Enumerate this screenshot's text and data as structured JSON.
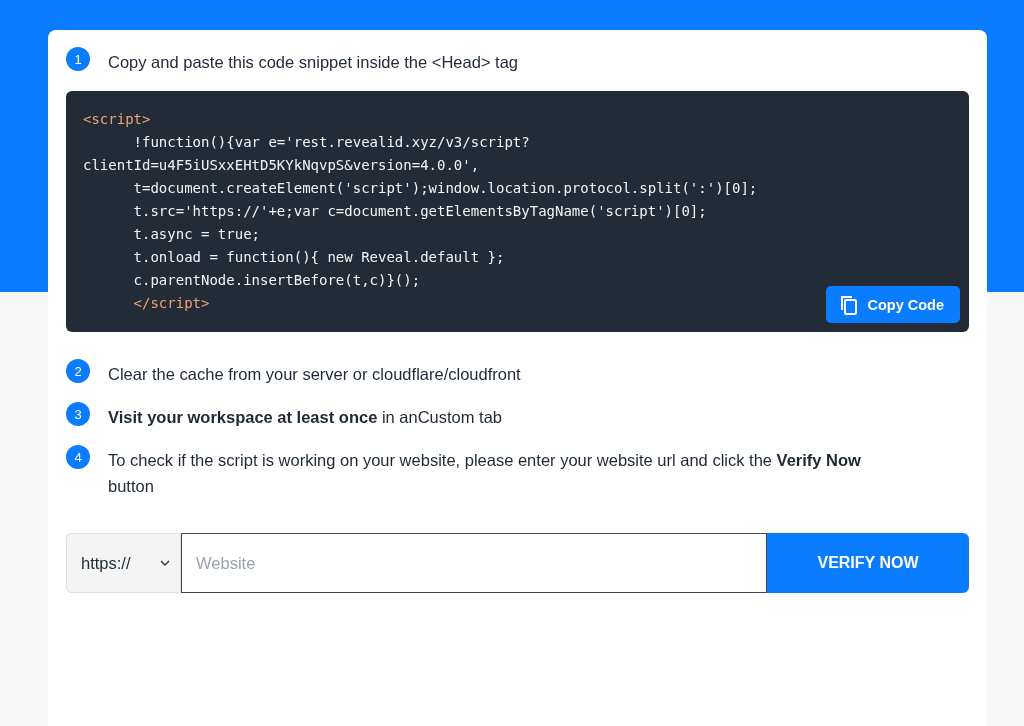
{
  "steps": [
    {
      "number": "1",
      "text": "Copy and paste this code snippet inside the <Head> tag"
    },
    {
      "number": "2",
      "text": "Clear the cache from your server or cloudflare/cloudfront"
    },
    {
      "number": "3",
      "text": "**Visit your workspace at least once** in anCustom tab"
    },
    {
      "number": "4",
      "text": "To check if the script is working on your website, please enter your website url and click the **Verify Now** button"
    }
  ],
  "code": {
    "lines": [
      {
        "kind": "tag",
        "text": "<script>"
      },
      {
        "kind": "code",
        "text": "      !function(){var e='rest.revealid.xyz/v3/script?"
      },
      {
        "kind": "code",
        "text": "clientId=u4F5iUSxxEHtD5KYkNqvpS&version=4.0.0',"
      },
      {
        "kind": "code",
        "text": "      t=document.createElement('script');window.location.protocol.split(':')[0];"
      },
      {
        "kind": "code",
        "text": "      t.src='https://'+e;var c=document.getElementsByTagName('script')[0];"
      },
      {
        "kind": "code",
        "text": "      t.async = true;"
      },
      {
        "kind": "code",
        "text": "      t.onload = function(){ new Reveal.default };"
      },
      {
        "kind": "code",
        "text": "      c.parentNode.insertBefore(t,c)}();"
      },
      {
        "kind": "tag",
        "text": "      </script>"
      }
    ],
    "copy_button": "Copy Code"
  },
  "verify": {
    "protocol": "https://",
    "placeholder": "Website",
    "button": "VERIFY NOW"
  }
}
